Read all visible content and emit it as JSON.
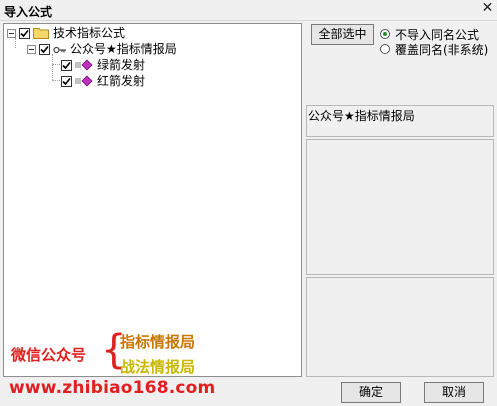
{
  "window": {
    "title": "导入公式"
  },
  "tree": {
    "root": {
      "label": "技术指标公式",
      "checked": true
    },
    "group": {
      "label": "公众号★指标情报局",
      "checked": true
    },
    "items": [
      {
        "label": "绿箭发射",
        "checked": true
      },
      {
        "label": "红箭发射",
        "checked": true
      }
    ]
  },
  "watermark": {
    "prefix": "微信公众号",
    "brace": "{",
    "line1": "指标情报局",
    "line2": "战法情报局",
    "url": "www.zhibiao168.com"
  },
  "buttons": {
    "select_all": "全部选中",
    "ok": "确定",
    "cancel": "取消"
  },
  "options": [
    {
      "label": "不导入同名公式",
      "selected": true
    },
    {
      "label": "覆盖同名(非系统)",
      "selected": false
    }
  ],
  "info": {
    "name": "公众号★指标情报局"
  },
  "colors": {
    "watermark_red": "#e02020",
    "watermark_orange": "#c87800",
    "watermark_yellow": "#c8b800"
  }
}
